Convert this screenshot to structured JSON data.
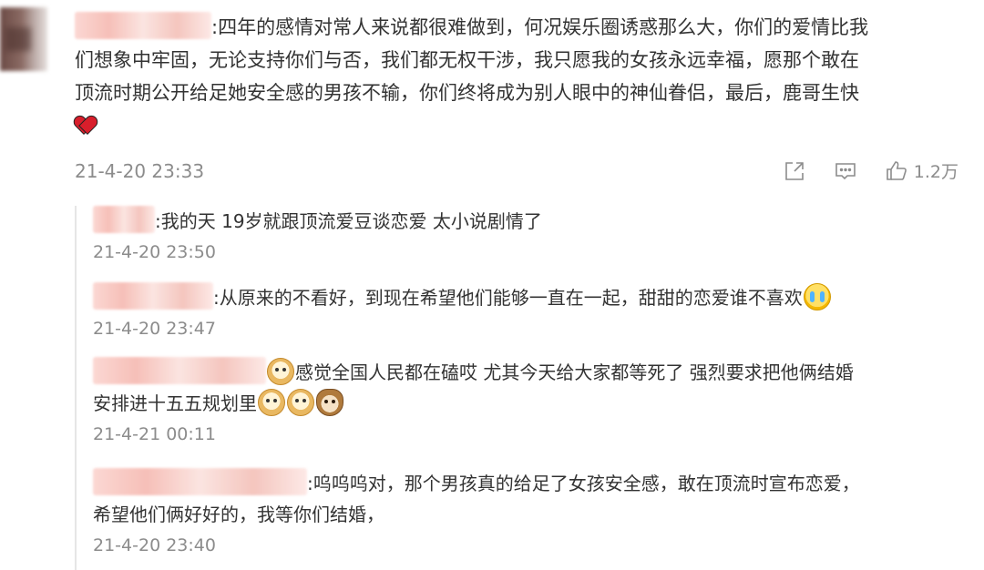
{
  "main_comment": {
    "lines": [
      ":四年的感情对常人来说都很难做到，何况娱乐圈诱惑那么大，你们的爱情比我",
      "们想象中牢固，无论支持你们与否，我们都无权干涉，我只愿我的女孩永远幸福，愿那个敢在",
      "顶流时期公开给足她安全感的男孩不输，你们终将成为别人眼中的神仙眷侣，最后，鹿哥生快"
    ],
    "emoji": "heart",
    "time": "21-4-20 23:33",
    "like_count": "1.2万",
    "icons": [
      "share-icon",
      "comment-icon",
      "like-icon"
    ]
  },
  "replies": [
    {
      "text": ":我的天 19岁就跟顶流爱豆谈恋爱 太小说剧情了",
      "time": "21-4-20 23:50"
    },
    {
      "text": ":从原来的不看好，到现在希望他们能够一直在一起，甜甜的恋爱谁不喜欢",
      "emoji": "cry",
      "time": "21-4-20 23:47"
    },
    {
      "text1": "感觉全国人民都在磕哎 尤其今天给大家都等死了 强烈要求把他俩结婚",
      "text2": "安排进十五五规划里",
      "emojis": [
        "doge",
        "doge",
        "cat"
      ],
      "time": "21-4-21 00:11"
    },
    {
      "text1": ":呜呜呜对，那个男孩真的给足了女孩安全感，敢在顶流时宣布恋爱，",
      "text2": "希望他们俩好好的，我等你们结婚，",
      "time": "21-4-20 23:40"
    }
  ]
}
